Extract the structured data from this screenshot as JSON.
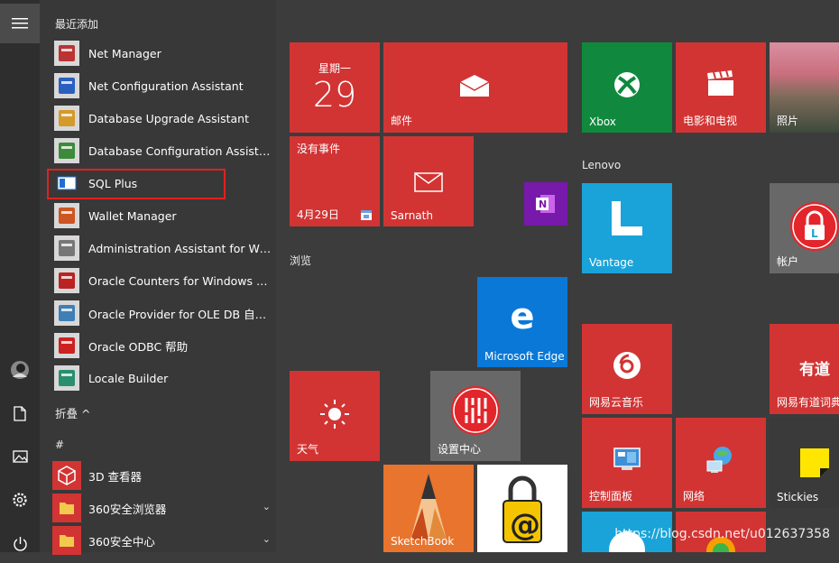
{
  "recent_header": "最近添加",
  "apps": [
    {
      "label": "Net Manager",
      "icon": "net-manager-icon"
    },
    {
      "label": "Net Configuration Assistant",
      "icon": "net-config-icon"
    },
    {
      "label": "Database Upgrade Assistant",
      "icon": "db-upgrade-icon"
    },
    {
      "label": "Database Configuration Assistant",
      "icon": "db-config-icon"
    },
    {
      "label": "SQL Plus",
      "icon": "sqlplus-icon"
    },
    {
      "label": "Wallet Manager",
      "icon": "wallet-icon"
    },
    {
      "label": "Administration Assistant for Win...",
      "icon": "admin-assistant-icon"
    },
    {
      "label": "Oracle Counters for Windows Per...",
      "icon": "oracle-counters-icon"
    },
    {
      "label": "Oracle Provider for OLE DB 自述...",
      "icon": "oracle-provider-icon"
    },
    {
      "label": "Oracle ODBC 帮助",
      "icon": "odbc-help-icon"
    },
    {
      "label": "Locale Builder",
      "icon": "locale-builder-icon"
    }
  ],
  "collapse_label": "折叠 ^",
  "hash_header": "#",
  "hash_apps": [
    {
      "label": "3D 查看器",
      "icon": "3d-viewer-icon"
    },
    {
      "label": "360安全浏览器",
      "icon": "folder-icon",
      "expandable": true
    },
    {
      "label": "360安全中心",
      "icon": "folder-icon",
      "expandable": true
    }
  ],
  "group_browse": "浏览",
  "group_lenovo": "Lenovo",
  "tiles": {
    "calendar_day": "星期一",
    "calendar_date": "29",
    "mail": "邮件",
    "no_events": "没有事件",
    "event_date": "4月29日",
    "sarnath": "Sarnath",
    "edge": "Microsoft Edge",
    "weather": "天气",
    "settings_center": "设置中心",
    "sketchbook": "SketchBook",
    "xbox": "Xbox",
    "movies": "电影和电视",
    "photos": "照片",
    "vantage": "Vantage",
    "account": "帐户",
    "netease_music": "网易云音乐",
    "youdao": "网易有道词典",
    "youdao_logo": "有道",
    "control_panel": "控制面板",
    "network": "网络",
    "stickies": "Stickies"
  },
  "watermark": "https://blog.csdn.net/u012637358",
  "colors": {
    "tile_red": "#d23434",
    "edge_blue": "#0a78d7",
    "xbox_green": "#10893e",
    "vantage_blue": "#1aa3d8",
    "selection_red": "#e0221e"
  }
}
